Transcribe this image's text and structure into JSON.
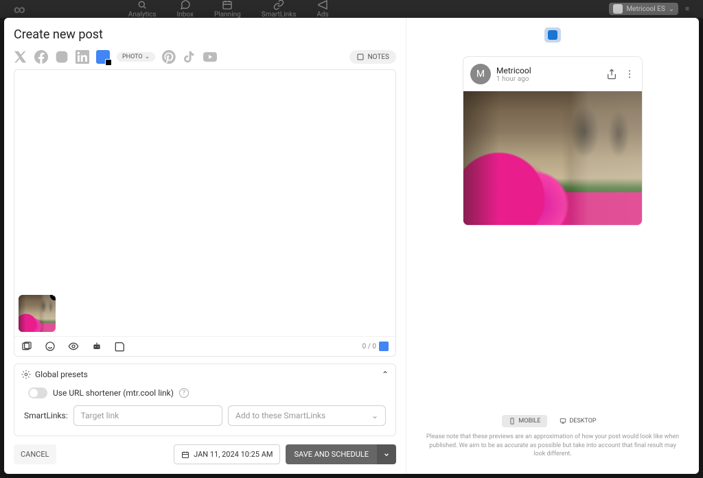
{
  "topnav": {
    "items": [
      "Analytics",
      "Inbox",
      "Planning",
      "SmartLinks",
      "Ads"
    ],
    "brand_name": "Metricool ES"
  },
  "modal": {
    "title": "Create new post",
    "photo_pill": "PHOTO",
    "notes_btn": "NOTES",
    "char_count": "0 / 0",
    "presets_title": "Global presets",
    "shortener_label": "Use URL shortener (mtr.cool link)",
    "smartlinks_label": "SmartLinks:",
    "target_placeholder": "Target link",
    "add_placeholder": "Add to these SmartLinks",
    "cancel": "CANCEL",
    "date": "JAN 11, 2024 10:25 AM",
    "save": "SAVE AND SCHEDULE"
  },
  "preview": {
    "avatar_letter": "M",
    "name": "Metricool",
    "time": "1 hour ago",
    "mobile": "MOBILE",
    "desktop": "DESKTOP",
    "disclaimer": "Please note that these previews are an approximation of how your post would look like when published. We aim to be as accurate as possible but take into account that final result may look different."
  }
}
